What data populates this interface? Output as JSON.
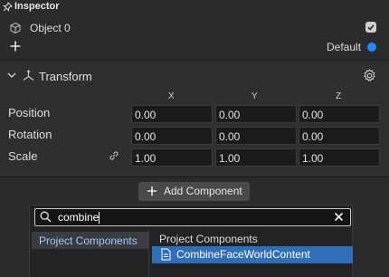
{
  "panel": {
    "title": "Inspector"
  },
  "object": {
    "name": "Object 0",
    "enabled": true
  },
  "layer": {
    "label": "Default",
    "color": "#1a8cff"
  },
  "transform": {
    "title": "Transform",
    "axes": [
      "X",
      "Y",
      "Z"
    ],
    "rows": [
      {
        "label": "Position",
        "values": [
          "0.00",
          "0.00",
          "0.00"
        ]
      },
      {
        "label": "Rotation",
        "values": [
          "0.00",
          "0.00",
          "0.00"
        ]
      },
      {
        "label": "Scale",
        "values": [
          "1.00",
          "1.00",
          "1.00"
        ]
      }
    ]
  },
  "add_component": {
    "label": "Add Component"
  },
  "picker": {
    "search_value": "combine",
    "categories": [
      "Project Components"
    ],
    "selected_category": "Project Components",
    "results_header": "Project Components",
    "results": [
      "CombineFaceWorldContent"
    ]
  },
  "colors": {
    "accent": "#1a8cff",
    "selection": "#2f6fb8"
  }
}
